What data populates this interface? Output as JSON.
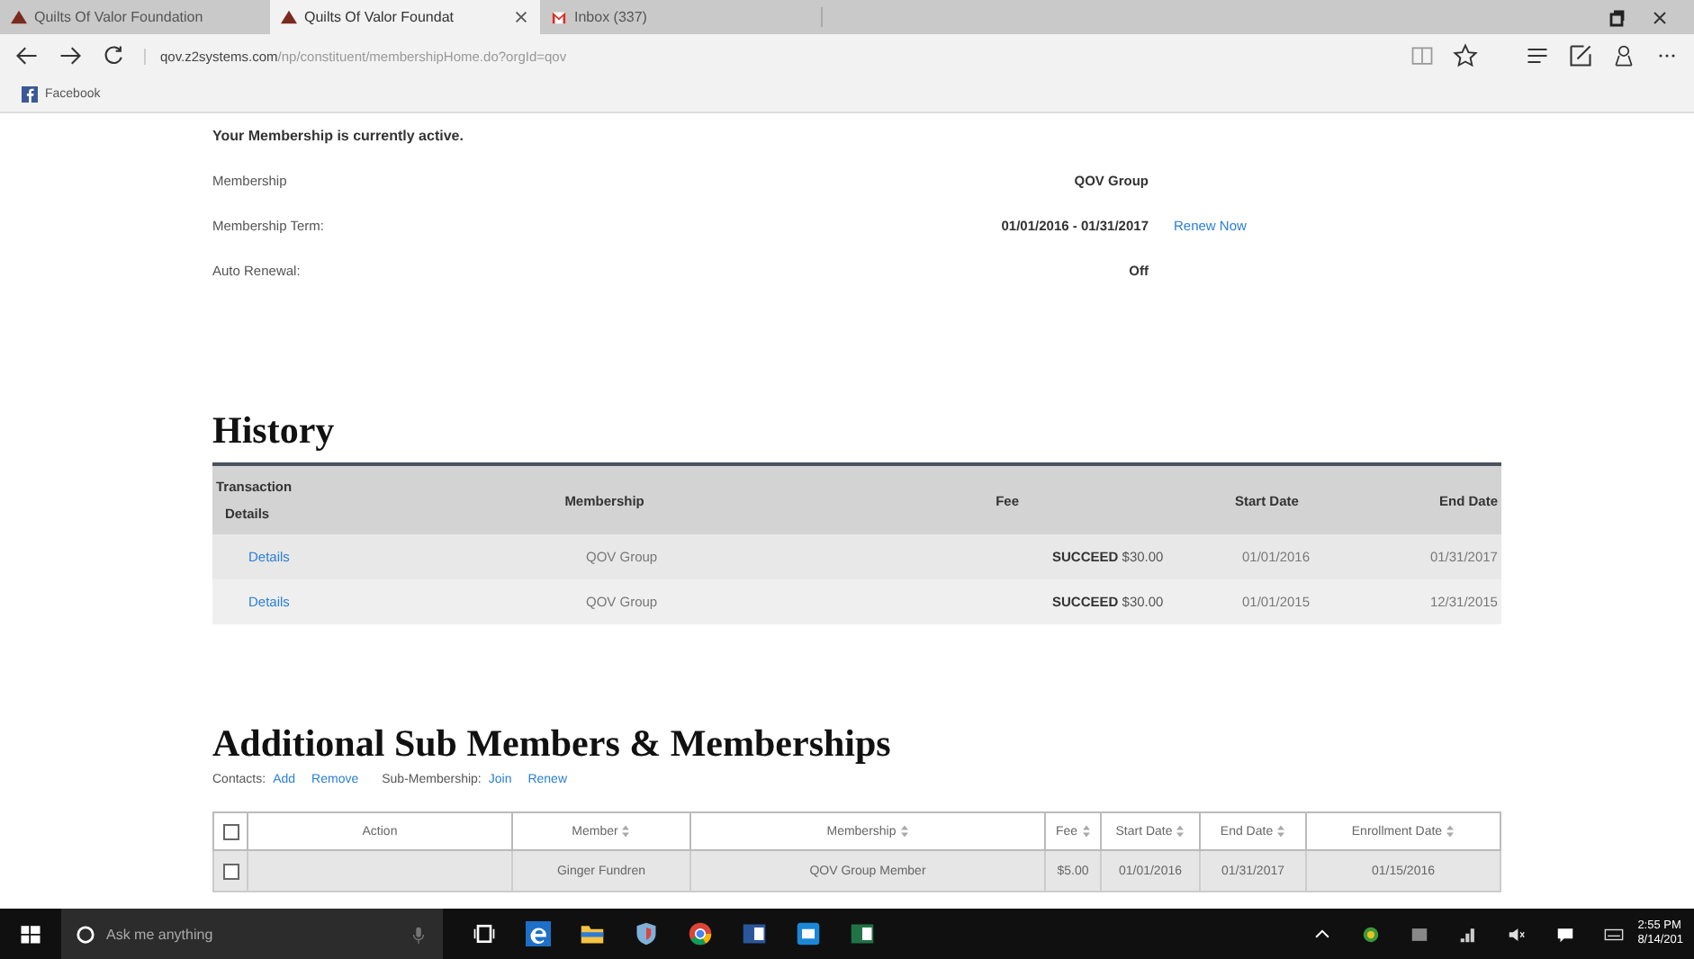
{
  "browser": {
    "tabs": [
      {
        "title": "Quilts Of Valor Foundation",
        "kind": "quilt",
        "selected": false,
        "closable": false
      },
      {
        "title": "Quilts Of Valor Foundat",
        "kind": "quilt",
        "selected": true,
        "closable": true
      },
      {
        "title": "Inbox (337)",
        "kind": "mail",
        "selected": false,
        "closable": false
      }
    ],
    "url_domain": "qov.z2systems.com",
    "url_path": "/np/constituent/membershipHome.do?orgId=qov",
    "favorites": [
      {
        "label": "Facebook"
      }
    ]
  },
  "status": {
    "message": "Your Membership is currently active.",
    "rows": [
      {
        "label": "Membership",
        "value": "QOV Group"
      },
      {
        "label": "Membership Term:",
        "value": "01/01/2016 - 01/31/2017",
        "link": "Renew Now"
      },
      {
        "label": "Auto Renewal:",
        "value": "Off"
      }
    ]
  },
  "history": {
    "title": "History",
    "columns": [
      "Transaction",
      "Details",
      "Membership",
      "Fee",
      "Start Date",
      "End Date"
    ],
    "rows": [
      {
        "details": "Details",
        "membership": "QOV Group",
        "status": "SUCCEED",
        "fee": "$30.00",
        "start": "01/01/2016",
        "end": "01/31/2017"
      },
      {
        "details": "Details",
        "membership": "QOV Group",
        "status": "SUCCEED",
        "fee": "$30.00",
        "start": "01/01/2015",
        "end": "12/31/2015"
      }
    ]
  },
  "sub_members": {
    "title": "Additional Sub Members & Memberships",
    "actions": [
      {
        "kind": "label",
        "text": "Contacts:"
      },
      {
        "kind": "link",
        "text": "Add"
      },
      {
        "kind": "link",
        "text": "Remove"
      },
      {
        "kind": "label",
        "text": "Sub-Membership:"
      },
      {
        "kind": "link",
        "text": "Join"
      },
      {
        "kind": "link",
        "text": "Renew"
      }
    ],
    "select_all": {
      "checked": false
    },
    "columns": [
      "Action",
      "Member",
      "Membership",
      "Fee",
      "Start Date",
      "End Date",
      "Enrollment Date"
    ],
    "rows": [
      {
        "checked": false,
        "member": "Ginger Fundren",
        "membership": "QOV Group Member",
        "fee": "$5.00",
        "start": "01/01/2016",
        "end": "01/31/2017",
        "enrollment": "01/15/2016"
      }
    ]
  },
  "taskbar": {
    "search_placeholder": "Ask me anything",
    "time": "2:55 PM",
    "date": "8/14/201"
  }
}
